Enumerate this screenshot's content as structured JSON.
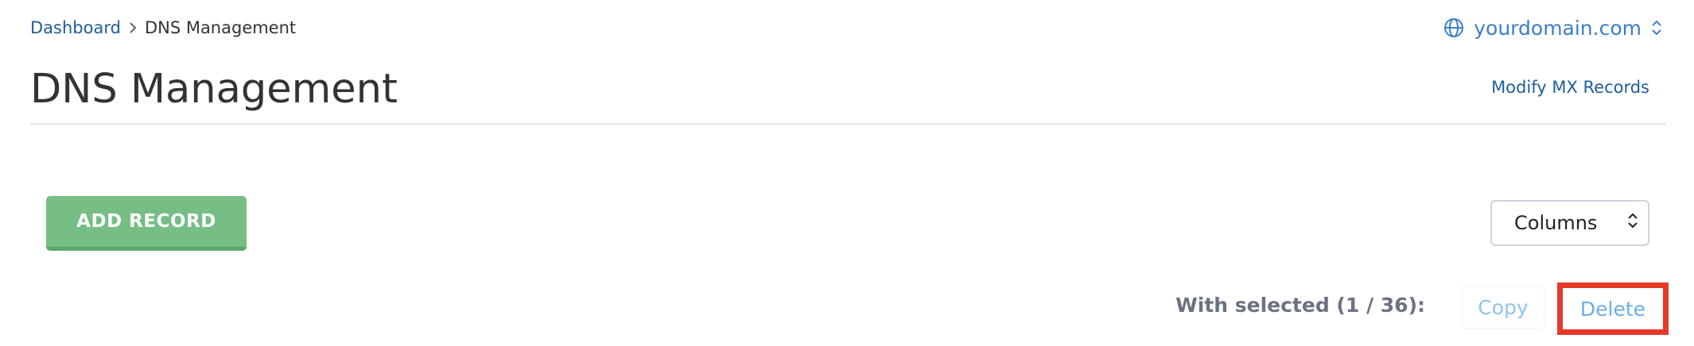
{
  "breadcrumb": {
    "home_label": "Dashboard",
    "separator_icon": "chevron-right-icon",
    "current_label": "DNS Management"
  },
  "domain_selector": {
    "value": "yourdomain.com",
    "icon": "globe-icon",
    "toggle_icon": "chevron-updown-icon"
  },
  "page": {
    "title": "DNS Management",
    "modify_link_label": "Modify MX Records"
  },
  "toolbar": {
    "add_record_label": "ADD RECORD",
    "columns_label": "Columns"
  },
  "bulk_actions": {
    "label": "With selected (1 / 36):",
    "copy_label": "Copy",
    "delete_label": "Delete"
  },
  "colors": {
    "link": "#1f5d9c",
    "accent_blue": "#3a7fc7",
    "add_button": "#76be84",
    "highlight": "#e5392a"
  }
}
